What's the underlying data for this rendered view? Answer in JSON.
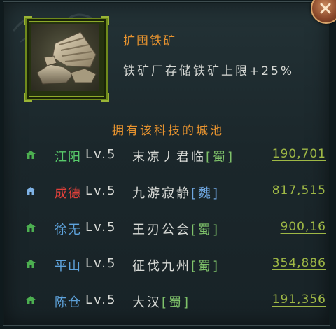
{
  "tech": {
    "name": "扩囤铁矿",
    "description": "铁矿厂存储铁矿上限+25%",
    "icon": "iron-ore-rock-icon"
  },
  "section_title": "拥有该科技的城池",
  "cities": [
    {
      "name": "江阳",
      "name_color": "#58c96a",
      "level": "Lv.5",
      "player": "末凉丿君临",
      "faction": "[蜀]",
      "faction_color": "#7fc26a",
      "icon_color": "#4caf50",
      "coords": "190,701"
    },
    {
      "name": "成德",
      "name_color": "#e0403a",
      "level": "Lv.5",
      "player": "九游寂静",
      "faction": "[魏]",
      "faction_color": "#6fa6e0",
      "icon_color": "#7fb3e6",
      "coords": "817,515"
    },
    {
      "name": "徐无",
      "name_color": "#5ea3dc",
      "level": "Lv.5",
      "player": "王刃公会",
      "faction": "[蜀]",
      "faction_color": "#7fc26a",
      "icon_color": "#4caf50",
      "coords": "900,16"
    },
    {
      "name": "平山",
      "name_color": "#5ea3dc",
      "level": "Lv.5",
      "player": "征伐九州",
      "faction": "[蜀]",
      "faction_color": "#7fc26a",
      "icon_color": "#4caf50",
      "coords": "354,886"
    },
    {
      "name": "陈仓",
      "name_color": "#5ea3dc",
      "level": "Lv.5",
      "player": "大汉",
      "faction": "[蜀]",
      "faction_color": "#7fc26a",
      "icon_color": "#4caf50",
      "coords": "191,356"
    }
  ],
  "colors": {
    "accent_orange": "#e7932f",
    "link_green": "#9fb845"
  }
}
